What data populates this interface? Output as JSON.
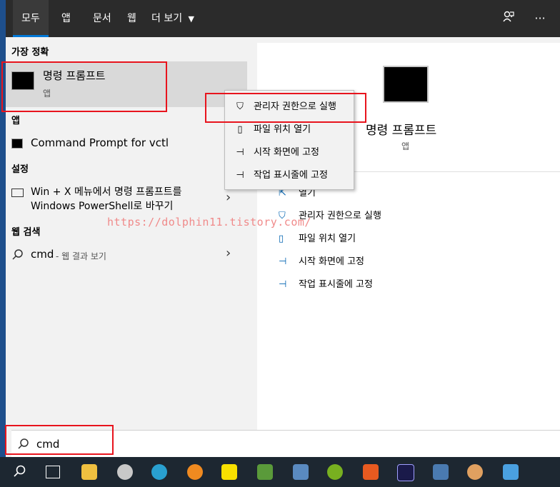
{
  "topbar": {
    "tabs": [
      "모두",
      "앱",
      "문서",
      "웹",
      "더 보기"
    ],
    "feedback_icon": "feedback-icon",
    "more_icon": "ellipsis-icon",
    "more_dropdown_icon": "caret-down-icon"
  },
  "left": {
    "best_match_header": "가장 정확",
    "best_match": {
      "title": "명령 프롬프트",
      "subtitle": "앱"
    },
    "apps_header": "앱",
    "app_item": "Command Prompt for vctl",
    "settings_header": "설정",
    "settings_item_line1": "Win + X 메뉴에서 명령 프롬프트를",
    "settings_item_line2": "Windows PowerShell로 바꾸기",
    "web_header": "웹 검색",
    "web_query": "cmd",
    "web_suffix": " - 웹 결과 보기"
  },
  "context_menu": {
    "items": [
      {
        "icon": "shield-icon",
        "label": "관리자 권한으로 실행"
      },
      {
        "icon": "folder-icon",
        "label": "파일 위치 열기"
      },
      {
        "icon": "pin-icon",
        "label": "시작 화면에 고정"
      },
      {
        "icon": "pin-icon",
        "label": "작업 표시줄에 고정"
      }
    ]
  },
  "right": {
    "app_title": "명령 프롬프트",
    "app_subtitle": "앱",
    "actions": [
      {
        "icon": "open-icon",
        "label": "열기"
      },
      {
        "icon": "shield-icon",
        "label": "관리자 권한으로 실행"
      },
      {
        "icon": "folder-icon",
        "label": "파일 위치 열기"
      },
      {
        "icon": "pin-icon",
        "label": "시작 화면에 고정"
      },
      {
        "icon": "pin-icon",
        "label": "작업 표시줄에 고정"
      }
    ]
  },
  "watermark": "https://dolphin11.tistory.com/",
  "search": {
    "value": "cmd"
  },
  "colors": {
    "accent": "#0078d7",
    "highlight": "#e8141d",
    "taskbar": "#1d2731"
  }
}
